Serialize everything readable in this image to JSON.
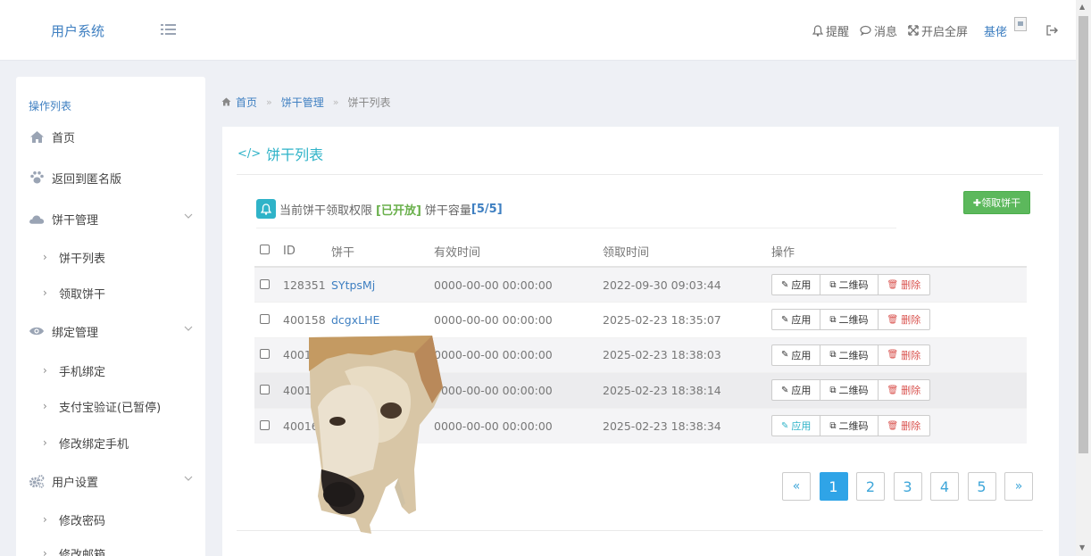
{
  "header": {
    "brand": "用户系统",
    "nav": {
      "remind": "提醒",
      "messages": "消息",
      "fullscreen": "开启全屏",
      "user": "基佬"
    }
  },
  "sidebar": {
    "heading": "操作列表",
    "home": "首页",
    "back_anon": "返回到匿名版",
    "cookie_mgmt": "饼干管理",
    "cookie_list": "饼干列表",
    "claim_cookie": "领取饼干",
    "bind_mgmt": "绑定管理",
    "phone_bind": "手机绑定",
    "alipay_verify": "支付宝验证(已暂停)",
    "change_phone": "修改绑定手机",
    "user_settings": "用户设置",
    "change_password": "修改密码",
    "change_email": "修改邮箱"
  },
  "breadcrumb": {
    "home": "首页",
    "cookie_mgmt": "饼干管理",
    "current": "饼干列表"
  },
  "panel": {
    "title": "饼干列表",
    "notice_prefix": "当前饼干领取权限",
    "notice_status": "[已开放]",
    "notice_capacity_label": "饼干容量",
    "notice_capacity": "[5/5]",
    "claim_button": "✚领取饼干"
  },
  "table": {
    "headers": {
      "id": "ID",
      "cookie": "饼干",
      "valid_time": "有效时间",
      "claim_time": "领取时间",
      "actions": "操作"
    },
    "action_labels": {
      "apply": "应用",
      "qrcode": "二维码",
      "delete": "删除"
    },
    "rows": [
      {
        "id": "128351",
        "cookie": "SYtpsMj",
        "valid": "0000-00-00 00:00:00",
        "claimed": "2022-09-30 09:03:44"
      },
      {
        "id": "400158",
        "cookie": "dcgxLHE",
        "valid": "0000-00-00 00:00:00",
        "claimed": "2025-02-23 18:35:07"
      },
      {
        "id": "40015",
        "cookie": "",
        "valid": "0000-00-00 00:00:00",
        "claimed": "2025-02-23 18:38:03"
      },
      {
        "id": "40016",
        "cookie": "",
        "valid": "0000-00-00 00:00:00",
        "claimed": "2025-02-23 18:38:14"
      },
      {
        "id": "400161",
        "cookie": "",
        "valid": "0000-00-00 00:00:00",
        "claimed": "2025-02-23 18:38:34"
      }
    ]
  },
  "pagination": {
    "prev": "«",
    "pages": [
      "1",
      "2",
      "3",
      "4",
      "5"
    ],
    "next": "»",
    "current": "1"
  },
  "colors": {
    "accent": "#2fb3c8",
    "brand": "#3e7fc1",
    "success": "#5cb85c",
    "danger": "#d9534f",
    "page_active": "#2fa4e7"
  }
}
